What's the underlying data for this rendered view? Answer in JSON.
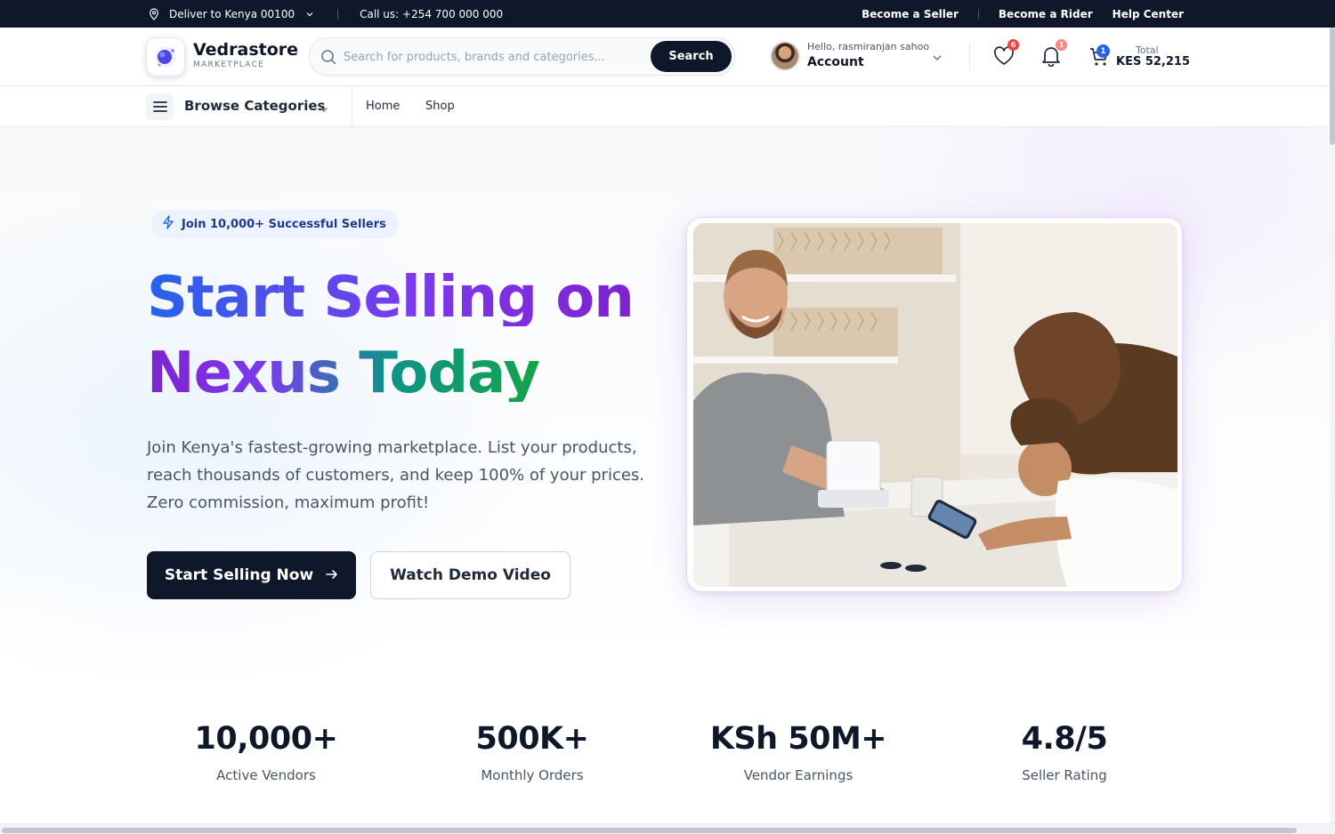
{
  "topbar": {
    "deliver": "Deliver to Kenya 00100",
    "call": "Call us: +254 700 000 000",
    "links": [
      "Become a Seller",
      "Become a Rider",
      "Help Center"
    ]
  },
  "header": {
    "logo_name": "Vedrastore",
    "logo_sub": "MARKETPLACE",
    "search_placeholder": "Search for products, brands and categories...",
    "search_button": "Search",
    "greeting": "Hello, rasmiranjan sahoo",
    "account": "Account",
    "wishlist_count": "6",
    "notification_count": "1",
    "cart_count": "1",
    "total_label": "Total",
    "total_value": "KES 52,215"
  },
  "nav": {
    "browse": "Browse Categories",
    "links": [
      "Home",
      "Shop"
    ]
  },
  "hero": {
    "pill": "Join 10,000+ Successful Sellers",
    "line1": "Start Selling on",
    "line2": "Nexus Today",
    "description": "Join Kenya's fastest-growing marketplace. List your products, reach thousands of customers, and keep 100% of your prices. Zero commission, maximum profit!",
    "cta_primary": "Start Selling Now",
    "cta_secondary": "Watch Demo Video"
  },
  "stats": [
    {
      "value": "10,000+",
      "label": "Active Vendors"
    },
    {
      "value": "500K+",
      "label": "Monthly Orders"
    },
    {
      "value": "KSh 50M+",
      "label": "Vendor Earnings"
    },
    {
      "value": "4.8/5",
      "label": "Seller Rating"
    }
  ],
  "colors": {
    "dark": "#0f172a",
    "accent_blue": "#2563eb",
    "accent_purple": "#7c3aed",
    "accent_green": "#16a34a",
    "badge_red": "#ef4444"
  }
}
